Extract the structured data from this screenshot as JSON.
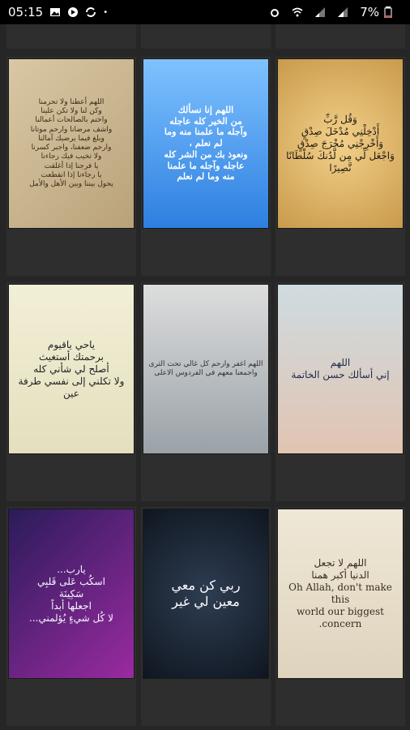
{
  "status_bar": {
    "time": "05:15",
    "battery": "7%"
  },
  "tiles": [
    {
      "text": "اللهم أعطنا ولا تحرمنا\nوكن لنا ولا تكن علينا\nواختم بالصالحات أعمالنا\nواشف مرضانا وارحم موتانا\nوبلغ فيما يرضيك آمالنا\nوارحم ضعفنا، واجبر كسرنا\nولا تخيب فيك رجاءنا\nيا فرجنا إذا أغلقت\nيا رجاءنا إذا انقطعت\nيحول بيننا وبين الأهل والأمل"
    },
    {
      "text": "اللهم إنا نسألك\nمن الخير كله عاجله\nوآجله ما علمنا منه وما\nلم نعلم ،\nونعوذ بك من الشر كله\nعاجله وآجله ما علمنا\nمنه وما لم نعلم"
    },
    {
      "text": "وَقُل رَّبِّ\nأَدْخِلْنِي مُدْخَلَ صِدْقٍ\nوَأَخْرِجْنِي مُخْرَجَ صِدْقٍ\nوَاجْعَل لِّي مِن لَّدُنكَ سُلْطَانًا نَّصِيرًا"
    },
    {
      "text": "ياحي ياقيوم\nبرحمتك أستغيث\nأصلح لي شأني كله\nولا تكلني إلى نفسي طرفة عين"
    },
    {
      "text": "اللهم اغفر وارحم كل غالي تحت الثرى\nواجمعنا معهم في الفردوس الاعلى"
    },
    {
      "text": "اللهم\nإني أسألك حسن الخاتمة"
    },
    {
      "text": "يارب...\nاسكُب عَلى قَلبِي\nسَكِينَة\nاجعلها أبداً\nلا كُل شيءٍ يُؤلمني..."
    },
    {
      "text": "ربي كن معي\nمعين لي غير"
    },
    {
      "text": "اللهم لا تجعل\nالدنيا أكبر همنا\nOh Allah, don't make this\nworld our biggest concern."
    }
  ]
}
